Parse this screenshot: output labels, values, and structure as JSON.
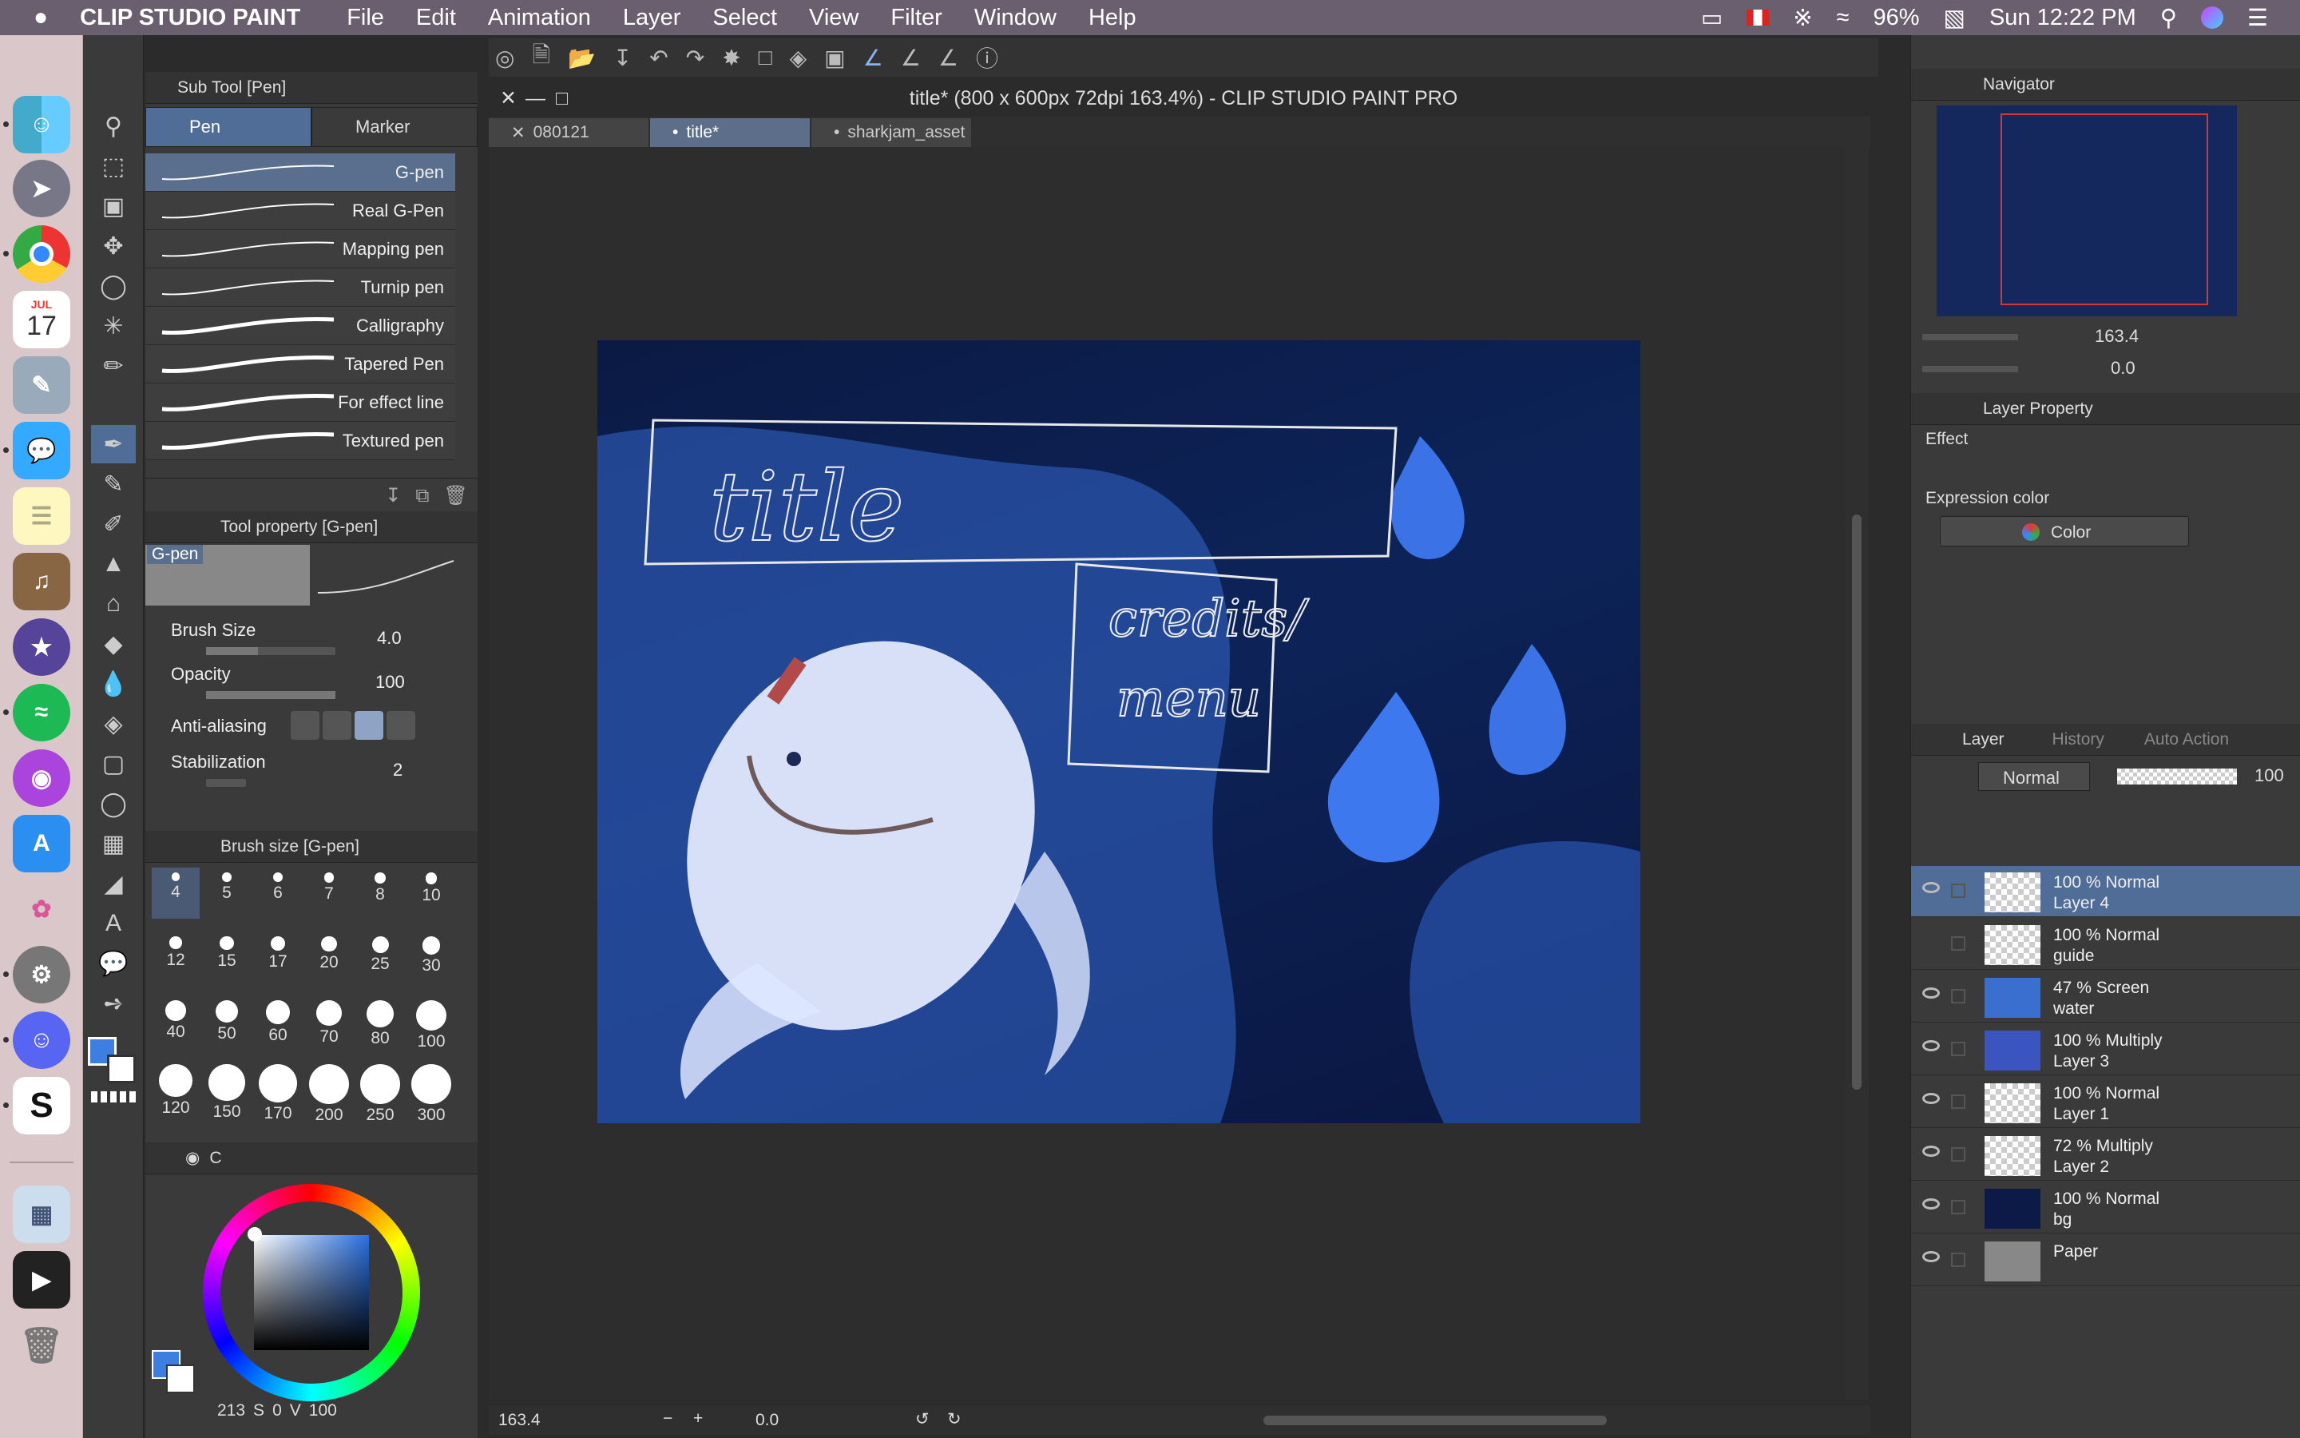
{
  "menubar": {
    "app": "CLIP STUDIO PAINT",
    "items": [
      "File",
      "Edit",
      "Animation",
      "Layer",
      "Select",
      "View",
      "Filter",
      "Window",
      "Help"
    ],
    "battery": "96%",
    "clock": "Sun 12:22 PM"
  },
  "dock": {
    "calendar_month": "JUL",
    "calendar_day": "17"
  },
  "subtool": {
    "title": "Sub Tool [Pen]",
    "tabs": [
      "Pen",
      "Marker"
    ],
    "brushes": [
      "G-pen",
      "Real G-Pen",
      "Mapping pen",
      "Turnip pen",
      "Calligraphy",
      "Tapered Pen",
      "For effect line",
      "Textured pen"
    ]
  },
  "toolprop": {
    "title": "Tool property [G-pen]",
    "preview_label": "G-pen",
    "brush_size_label": "Brush Size",
    "brush_size": "4.0",
    "opacity_label": "Opacity",
    "opacity": "100",
    "aa_label": "Anti-aliasing",
    "stab_label": "Stabilization",
    "stab": "2"
  },
  "brushsize": {
    "title": "Brush size [G-pen]",
    "sizes": [
      "4",
      "5",
      "6",
      "7",
      "8",
      "10",
      "12",
      "15",
      "17",
      "20",
      "25",
      "30",
      "40",
      "50",
      "60",
      "70",
      "80",
      "100",
      "120",
      "150",
      "170",
      "200",
      "250",
      "300"
    ]
  },
  "color": {
    "tab_c": "C",
    "readout_h": "213",
    "readout_s": "S",
    "readout_s_val": "0",
    "readout_v": "V",
    "readout_v_val": "100",
    "main": "#3d7fe0"
  },
  "document": {
    "title": "title* (800 x 600px 72dpi 163.4%)  - CLIP STUDIO PAINT PRO",
    "tabs": [
      "080121",
      "title*",
      "sharkjam_asset"
    ],
    "art_title": "title",
    "art_credits": "credits/",
    "art_menu": "menu"
  },
  "status": {
    "zoom": "163.4",
    "angle": "0.0"
  },
  "navigator": {
    "title": "Navigator",
    "zoom": "163.4",
    "rotate": "0.0"
  },
  "layerprop": {
    "title": "Layer Property",
    "effect": "Effect",
    "expr": "Expression color",
    "color_value": "Color"
  },
  "layers": {
    "tabs": [
      "Layer",
      "History",
      "Auto Action"
    ],
    "blend": "Normal",
    "opacity": "100",
    "items": [
      {
        "mode": "100 % Normal",
        "name": "Layer 4"
      },
      {
        "mode": "100 % Normal",
        "name": "guide"
      },
      {
        "mode": "47 % Screen",
        "name": "water"
      },
      {
        "mode": "100 % Multiply",
        "name": "Layer 3"
      },
      {
        "mode": "100 % Normal",
        "name": "Layer 1"
      },
      {
        "mode": "72 % Multiply",
        "name": "Layer 2"
      },
      {
        "mode": "100 % Normal",
        "name": "bg"
      },
      {
        "mode": "",
        "name": "Paper"
      }
    ]
  }
}
